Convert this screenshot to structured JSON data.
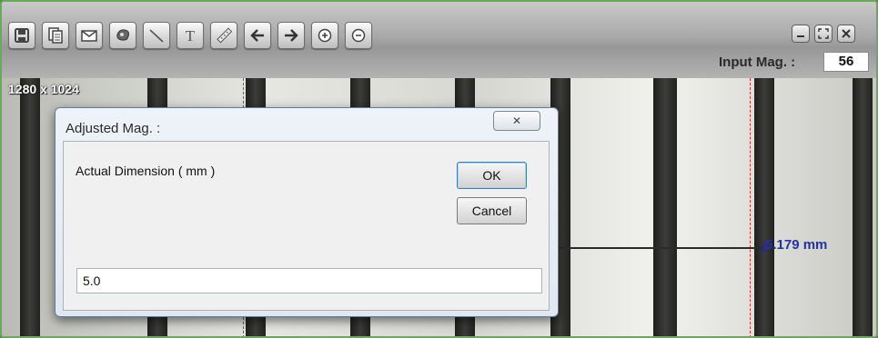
{
  "toolbar": {
    "tools": [
      {
        "icon": "save-icon"
      },
      {
        "icon": "copy-icon"
      },
      {
        "icon": "mail-icon"
      },
      {
        "icon": "stamp-icon"
      },
      {
        "icon": "line-icon"
      },
      {
        "icon": "text-icon"
      },
      {
        "icon": "ruler-icon"
      },
      {
        "icon": "arrow-left-icon"
      },
      {
        "icon": "arrow-right-icon"
      },
      {
        "icon": "zoom-in-icon"
      },
      {
        "icon": "zoom-out-icon"
      }
    ],
    "window_controls": [
      "minimize-icon",
      "maximize-icon",
      "close-icon"
    ],
    "input_mag_label": "Input Mag. :",
    "input_mag_value": "56"
  },
  "viewer": {
    "resolution": "1280 x 1024",
    "measurement": "5.179 mm"
  },
  "dialog": {
    "title": "Adjusted Mag. :",
    "close_symbol": "✕",
    "prompt": "Actual Dimension ( mm )",
    "ok_label": "OK",
    "cancel_label": "Cancel",
    "input_value": "5.0"
  },
  "colors": {
    "measure_text": "#2233aa",
    "guide_line": "#d2332e",
    "frame_border": "#6aa85a"
  }
}
